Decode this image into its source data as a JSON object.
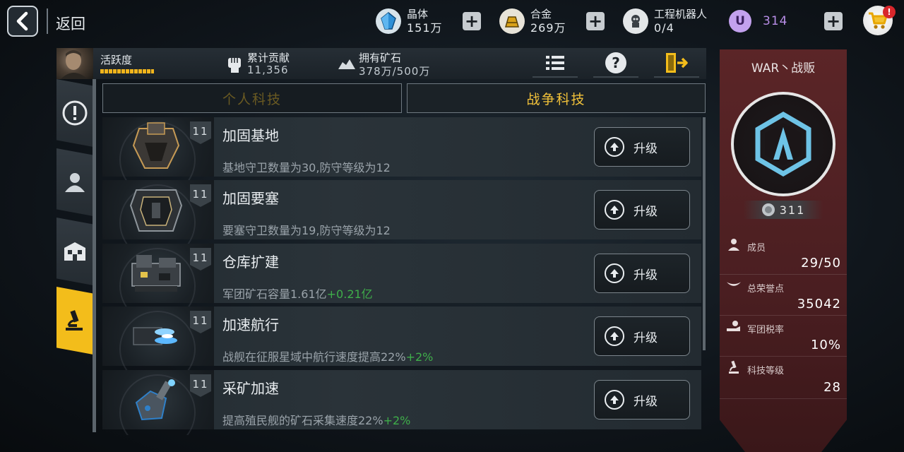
{
  "topbar": {
    "back_label": "返回",
    "crystal": {
      "name": "晶体",
      "value": "151万",
      "icon": "crystal-icon"
    },
    "alloy": {
      "name": "合金",
      "value": "269万",
      "icon": "alloy-icon"
    },
    "robot": {
      "name": "工程机器人",
      "value": "0/4",
      "icon": "robot-icon"
    },
    "u_currency": {
      "symbol": "U",
      "value": "314",
      "icon": "u-coin-icon"
    },
    "cart_badge": "!"
  },
  "infostrip": {
    "activity_label": "活跃度",
    "contribution_label": "累计贡献",
    "contribution_value": "11,356",
    "ore_label": "拥有矿石",
    "ore_value": "378万/500万"
  },
  "tabs": {
    "personal": "个人科技",
    "war": "战争科技"
  },
  "techs": [
    {
      "level": "11",
      "title": "加固基地",
      "desc": "基地守卫数量为30,防守等级为12",
      "bonus": "",
      "button": "升级"
    },
    {
      "level": "11",
      "title": "加固要塞",
      "desc": "要塞守卫数量为19,防守等级为12",
      "bonus": "",
      "button": "升级"
    },
    {
      "level": "11",
      "title": "仓库扩建",
      "desc": "军团矿石容量1.61亿",
      "bonus": "+0.21亿",
      "button": "升级"
    },
    {
      "level": "11",
      "title": "加速航行",
      "desc": "战舰在征服星域中航行速度提高22%",
      "bonus": "+2%",
      "button": "升级"
    },
    {
      "level": "11",
      "title": "采矿加速",
      "desc": "提高殖民舰的矿石采集速度22%",
      "bonus": "+2%",
      "button": "升级"
    }
  ],
  "guild": {
    "name": "WAR丶战贩",
    "power": "311",
    "members_label": "成员",
    "members_value": "29/50",
    "honor_label": "总荣誉点",
    "honor_value": "35042",
    "tax_label": "军团税率",
    "tax_value": "10%",
    "tech_label": "科技等级",
    "tech_value": "28"
  },
  "colors": {
    "accent_yellow": "#f3bd1b",
    "bonus_green": "#3fae4a",
    "panel_red": "#5b2527",
    "emblem_cyan": "#6ec3e6",
    "u_purple": "#b98ee8"
  }
}
